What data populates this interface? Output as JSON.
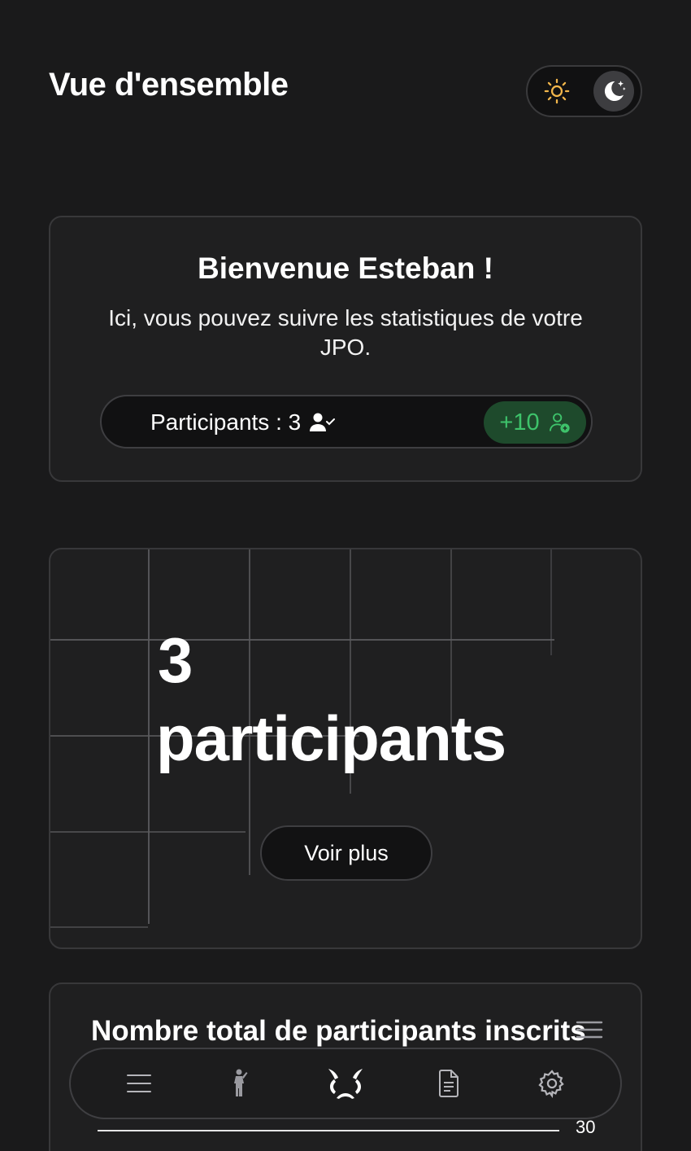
{
  "header": {
    "title": "Vue d'ensemble"
  },
  "theme": {
    "mode": "dark",
    "light_icon": "sun-icon",
    "dark_icon": "moon-stars-icon"
  },
  "welcome": {
    "title": "Bienvenue Esteban !",
    "text": "Ici, vous pouvez suivre les statistiques de votre JPO.",
    "participants_label": "Participants : 3",
    "participants_icon": "user-check-icon",
    "add_label": "+10",
    "add_icon": "user-add-icon",
    "add_color": "#3ec36b"
  },
  "stats": {
    "number": "3",
    "label": "participants",
    "button": "Voir plus"
  },
  "total": {
    "title": "Nombre total de participants inscrits",
    "menu_icon": "menu-icon",
    "axis_tick": "30"
  },
  "nav": {
    "items": [
      {
        "icon": "menu-icon"
      },
      {
        "icon": "person-icon"
      },
      {
        "icon": "dashboard-logo-icon",
        "active": true
      },
      {
        "icon": "document-icon"
      },
      {
        "icon": "gear-icon"
      }
    ]
  }
}
